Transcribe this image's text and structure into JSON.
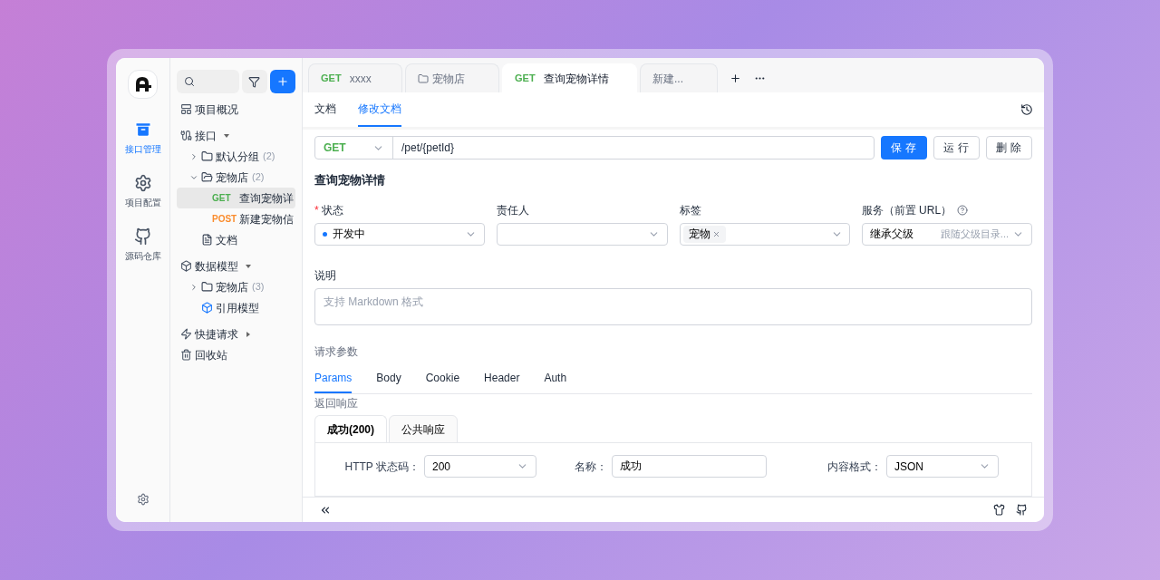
{
  "rail": {
    "items": [
      {
        "label": "接口管理",
        "selected": true
      },
      {
        "label": "项目配置",
        "selected": false
      },
      {
        "label": "源码仓库",
        "selected": false
      }
    ]
  },
  "sidebar": {
    "tree": [
      {
        "kind": "overview",
        "label": "项目概况"
      },
      {
        "kind": "api_section",
        "label": "接口",
        "expanded": true,
        "children": [
          {
            "kind": "folder",
            "label": "默认分组",
            "count": "(2)",
            "expanded": false
          },
          {
            "kind": "folder",
            "label": "宠物店",
            "count": "(2)",
            "expanded": true,
            "children": [
              {
                "kind": "endpoint",
                "method": "GET",
                "color": "#4caf50",
                "label": "查询宠物详",
                "selected": true
              },
              {
                "kind": "endpoint",
                "method": "POST",
                "color": "#fa8c2e",
                "label": "新建宠物信",
                "selected": false
              }
            ]
          },
          {
            "kind": "doc",
            "label": "文档"
          }
        ]
      },
      {
        "kind": "model_section",
        "label": "数据模型",
        "expanded": true,
        "children": [
          {
            "kind": "folder",
            "label": "宠物店",
            "count": "(3)",
            "expanded": false
          },
          {
            "kind": "model",
            "label": "引用模型"
          }
        ]
      },
      {
        "kind": "shortcut_section",
        "label": "快捷请求",
        "expanded": false
      },
      {
        "kind": "trash",
        "label": "回收站"
      }
    ]
  },
  "tabs": [
    {
      "kind": "request",
      "method": "GET",
      "label": "xxxx",
      "selected": false
    },
    {
      "kind": "folder",
      "label": "宠物店",
      "selected": false
    },
    {
      "kind": "request",
      "method": "GET",
      "label": "查询宠物详情",
      "selected": true
    },
    {
      "kind": "draft",
      "label": "新建...",
      "selected": false
    }
  ],
  "subtabs": [
    {
      "label": "文档",
      "selected": false
    },
    {
      "label": "修改文档",
      "selected": true
    }
  ],
  "url": {
    "method": "GET",
    "path": "/pet/{petId}",
    "buttons": [
      {
        "label": "保存",
        "primary": true
      },
      {
        "label": "运行",
        "primary": false
      },
      {
        "label": "删除",
        "primary": false
      }
    ]
  },
  "title": "查询宠物详情",
  "fields": [
    {
      "kind": "status",
      "label": "状态",
      "required_mark": "*",
      "value": "开发中",
      "color": "#1677ff"
    },
    {
      "kind": "select",
      "label": "责任人"
    },
    {
      "kind": "tags",
      "label": "标签",
      "tags": [
        "宠物"
      ]
    },
    {
      "kind": "service",
      "label": "服务（前置 URL）",
      "value": "继承父级",
      "hint": "跟随父级目录..."
    }
  ],
  "description": {
    "label": "说明",
    "placeholder": "支持 Markdown 格式"
  },
  "request_params": {
    "label": "请求参数",
    "tabs": [
      {
        "label": "Params",
        "selected": true
      },
      {
        "label": "Body",
        "selected": false
      },
      {
        "label": "Cookie",
        "selected": false
      },
      {
        "label": "Header",
        "selected": false
      },
      {
        "label": "Auth",
        "selected": false
      }
    ]
  },
  "response": {
    "label": "返回响应",
    "tabs": [
      {
        "label": "成功(200)",
        "selected": true
      },
      {
        "label": "公共响应",
        "selected": false
      }
    ],
    "row": [
      {
        "kind": "select",
        "label": "HTTP 状态码：",
        "value": "200"
      },
      {
        "kind": "input",
        "label": "名称：",
        "value": "成功"
      },
      {
        "kind": "select",
        "label": "内容格式：",
        "value": "JSON"
      }
    ]
  }
}
